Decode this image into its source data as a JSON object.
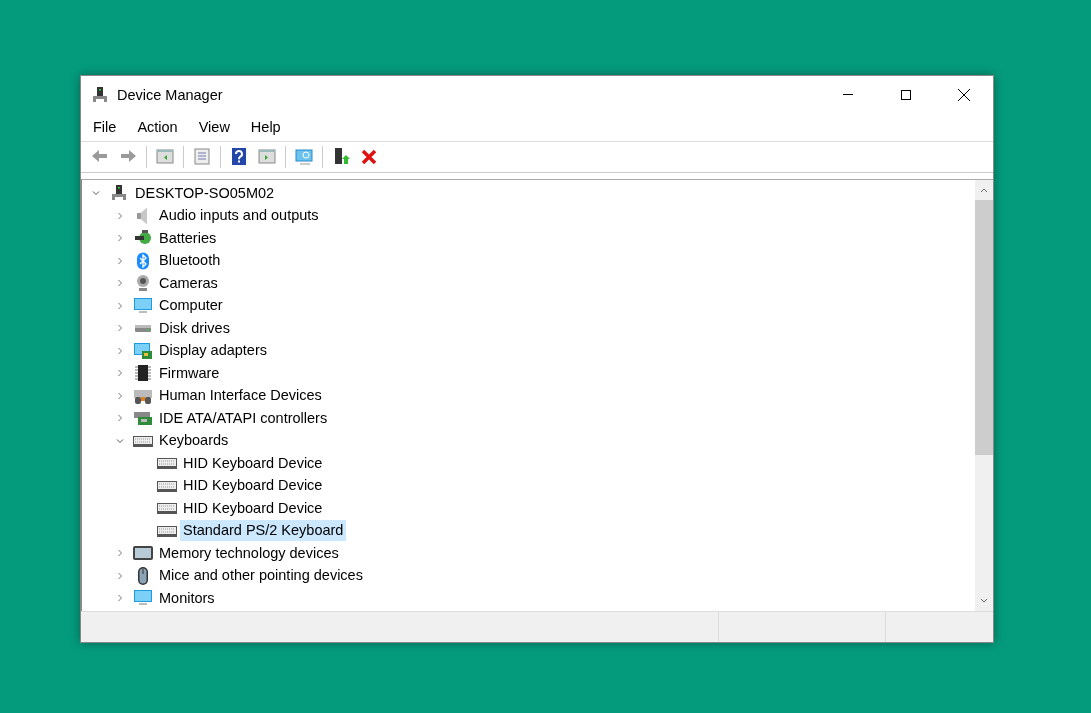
{
  "window": {
    "title": "Device Manager"
  },
  "menu": [
    {
      "label": "File"
    },
    {
      "label": "Action"
    },
    {
      "label": "View"
    },
    {
      "label": "Help"
    }
  ],
  "tree": {
    "label": "DESKTOP-SO05M02",
    "kind": "host",
    "expanded": true,
    "selected": false,
    "children": [
      {
        "label": "Audio inputs and outputs",
        "kind": "speaker",
        "expanded": false,
        "selected": false
      },
      {
        "label": "Batteries",
        "kind": "battery",
        "expanded": false,
        "selected": false
      },
      {
        "label": "Bluetooth",
        "kind": "bluetooth",
        "expanded": false,
        "selected": false
      },
      {
        "label": "Cameras",
        "kind": "camera",
        "expanded": false,
        "selected": false
      },
      {
        "label": "Computer",
        "kind": "monitor",
        "expanded": false,
        "selected": false
      },
      {
        "label": "Disk drives",
        "kind": "disk",
        "expanded": false,
        "selected": false
      },
      {
        "label": "Display adapters",
        "kind": "display",
        "expanded": false,
        "selected": false
      },
      {
        "label": "Firmware",
        "kind": "chip",
        "expanded": false,
        "selected": false
      },
      {
        "label": "Human Interface Devices",
        "kind": "hid",
        "expanded": false,
        "selected": false
      },
      {
        "label": "IDE ATA/ATAPI controllers",
        "kind": "ide",
        "expanded": false,
        "selected": false
      },
      {
        "label": "Keyboards",
        "kind": "keyboard",
        "expanded": true,
        "selected": false,
        "children": [
          {
            "label": "HID Keyboard Device",
            "kind": "keyboard",
            "selected": false
          },
          {
            "label": "HID Keyboard Device",
            "kind": "keyboard",
            "selected": false
          },
          {
            "label": "HID Keyboard Device",
            "kind": "keyboard",
            "selected": false
          },
          {
            "label": "Standard PS/2 Keyboard",
            "kind": "keyboard",
            "selected": true
          }
        ]
      },
      {
        "label": "Memory technology devices",
        "kind": "memory",
        "expanded": false,
        "selected": false
      },
      {
        "label": "Mice and other pointing devices",
        "kind": "mouse",
        "expanded": false,
        "selected": false
      },
      {
        "label": "Monitors",
        "kind": "monitor",
        "expanded": false,
        "selected": false
      }
    ]
  }
}
